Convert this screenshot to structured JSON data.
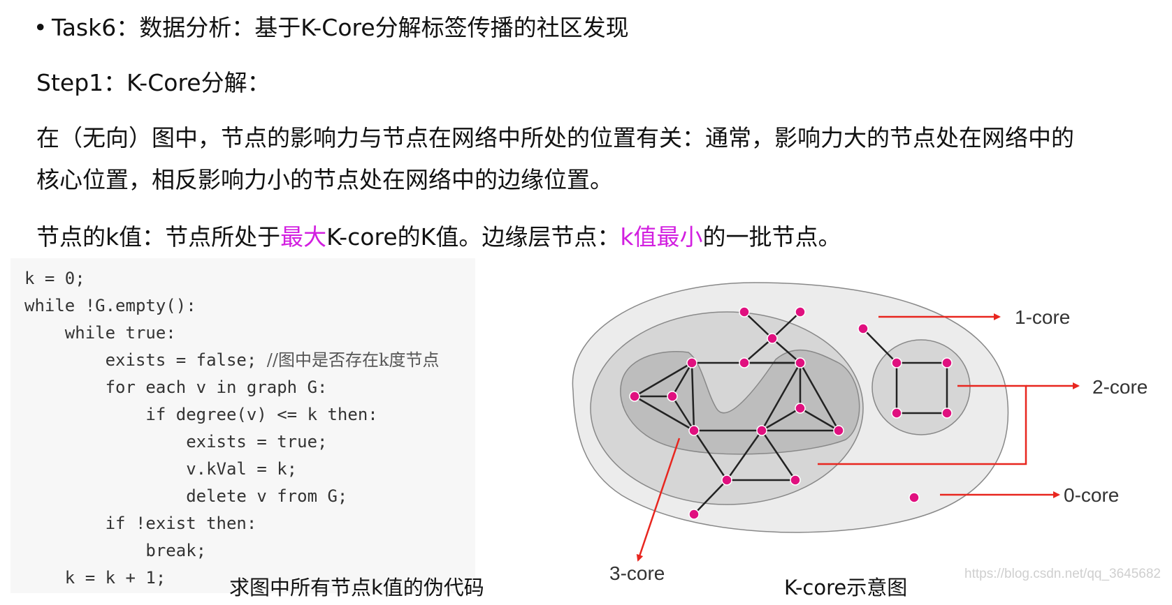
{
  "bullet": {
    "mark": "•",
    "text": "Task6：数据分析：基于K-Core分解标签传播的社区发现"
  },
  "step": "Step1：K-Core分解：",
  "paragraph": {
    "line1": "在（无向）图中，节点的影响力与节点在网络中所处的位置有关：通常，影响力大的节点处在网络中的",
    "line2": "核心位置，相反影响力小的节点处在网络中的边缘位置。"
  },
  "kvalue": {
    "p1": "节点的k值：节点所处于",
    "p2": "最大",
    "p3": "K-core的K值。边缘层节点：",
    "p4": "k值最小",
    "p5": "的一批节点。"
  },
  "code": {
    "l1": "k = 0;",
    "l2": "while !G.empty():",
    "l3": "    while true:",
    "l4": "        exists = false; ",
    "l4_comment": "//图中是否存在k度节点",
    "l5": "        for each v in graph G:",
    "l6": "            if degree(v) <= k then:",
    "l7": "                exists = true;",
    "l8": "                v.kVal = k;",
    "l9": "                delete v from G;",
    "l10": "        if !exist then:",
    "l11": "            break;",
    "l12": "    k = k + 1;"
  },
  "captions": {
    "code": "求图中所有节点k值的伪代码",
    "diagram": "K-core示意图"
  },
  "diagram": {
    "labels": {
      "one_core": "1-core",
      "two_core": "2-core",
      "zero_core": "0-core",
      "three_core": "3-core"
    },
    "colors": {
      "outer": "#ececec",
      "middle": "#d6d6d6",
      "inner": "#bdbdbd",
      "node": "#e0107f",
      "arrow": "#e8261f"
    }
  },
  "watermark": "https://blog.csdn.net/qq_3645682"
}
